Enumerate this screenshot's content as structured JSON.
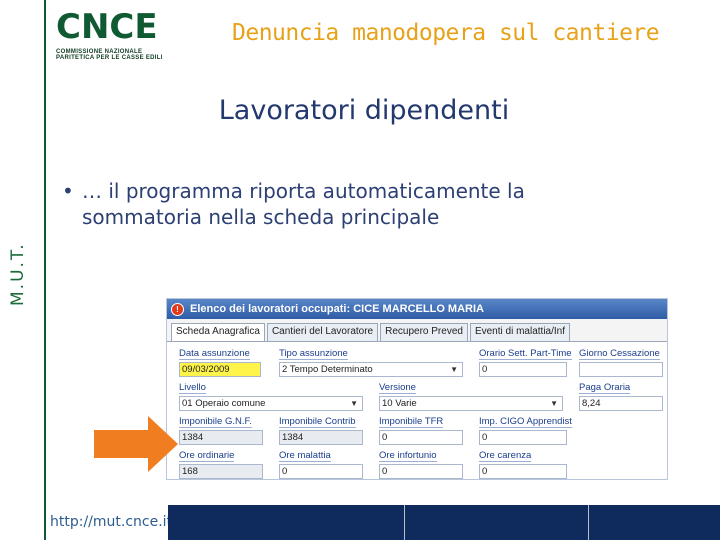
{
  "sidebar": {
    "vertical_label": "M.U.T."
  },
  "logo": {
    "word": "CNCE",
    "line1": "COMMISSIONE NAZIONALE",
    "line2": "PARITETICA PER LE CASSE EDILI"
  },
  "header": {
    "title": "Denuncia manodopera sul cantiere"
  },
  "slide": {
    "title": "Lavoratori dipendenti",
    "bullet_marker": "•",
    "bullet_text": "… il programma riporta automaticamente la sommatoria nella scheda principale"
  },
  "window": {
    "title": "Elenco dei lavoratori occupati: CICE MARCELLO MARIA",
    "tabs": [
      "Scheda Anagrafica",
      "Cantieri del Lavoratore",
      "Recupero Preved",
      "Eventi di malattia/Inf"
    ],
    "fields": {
      "data_assunzione": {
        "label": "Data assunzione",
        "value": "09/03/2009"
      },
      "tipo_assunzione": {
        "label": "Tipo assunzione",
        "value": "2 Tempo Determinato"
      },
      "orario_sett": {
        "label": "Orario Sett. Part-Time",
        "value": "0"
      },
      "giorno_cessazione": {
        "label": "Giorno Cessazione",
        "value": ""
      },
      "livello": {
        "label": "Livello",
        "value": "01 Operaio comune"
      },
      "versione": {
        "label": "Versione",
        "value": "10 Varie"
      },
      "paga_oraria": {
        "label": "Paga Oraria",
        "value": "8,24"
      },
      "imponibile_gnf": {
        "label": "Imponibile G.N.F.",
        "value": "1384"
      },
      "imponibile_contrib": {
        "label": "Imponibile Contrib",
        "value": "1384"
      },
      "imponibile_tfr": {
        "label": "Imponibile TFR",
        "value": "0"
      },
      "imp_cigo": {
        "label": "Imp. CIGO Apprendist",
        "value": "0"
      },
      "ore_ordinarie": {
        "label": "Ore ordinarie",
        "value": "168"
      },
      "ore_malattia": {
        "label": "Ore malattia",
        "value": "0"
      },
      "ore_infortunio": {
        "label": "Ore infortunio",
        "value": "0"
      },
      "ore_carenza": {
        "label": "Ore carenza",
        "value": "0"
      }
    }
  },
  "footer": {
    "url": "http://mut.cnce.it"
  },
  "colors": {
    "brand_green": "#0f5a32",
    "header_orange": "#e8a21a",
    "title_blue": "#22386e",
    "footer_navy": "#0f2a5c",
    "arrow_orange": "#f07d1f",
    "highlight_yellow": "#fff44a"
  }
}
